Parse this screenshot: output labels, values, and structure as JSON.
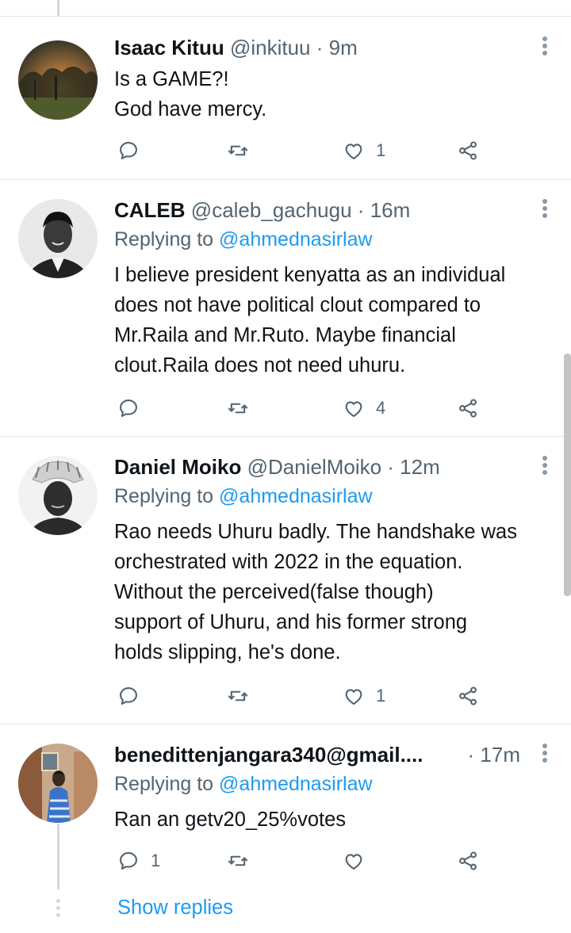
{
  "tweets": [
    {
      "name": "Isaac Kituu",
      "handle": "@inkituu",
      "dot": " · ",
      "time": "9m",
      "replying_prefix": "",
      "replying_to": "",
      "text": "Is a GAME?!\nGod have mercy.",
      "reply_count": "",
      "retweet_count": "",
      "like_count": "1",
      "avatar_icon": "avatar-sunset-trees"
    },
    {
      "name": "CALEB",
      "handle": "@caleb_gachugu",
      "dot": " · ",
      "time": "16m",
      "replying_prefix": "Replying to ",
      "replying_to": "@ahmednasirlaw",
      "text": "I believe president kenyatta as an individual\ndoes not have political clout compared to\nMr.Raila and Mr.Ruto. Maybe financial\nclout.Raila does not need uhuru.",
      "reply_count": "",
      "retweet_count": "",
      "like_count": "4",
      "avatar_icon": "avatar-man-suit"
    },
    {
      "name": "Daniel Moiko",
      "handle": "@DanielMoiko",
      "dot": " · ",
      "time": "12m",
      "replying_prefix": "Replying to ",
      "replying_to": "@ahmednasirlaw",
      "text": "Rao needs Uhuru badly. The handshake was\norchestrated with 2022 in the equation.\nWithout the perceived(false though)\nsupport of Uhuru, and his former strong\nholds slipping, he's done.",
      "reply_count": "",
      "retweet_count": "",
      "like_count": "1",
      "avatar_icon": "avatar-man-headdress"
    },
    {
      "name": "benedittenjangara340@gmail....",
      "handle": "",
      "dot": " · ",
      "time": "17m",
      "replying_prefix": "Replying to ",
      "replying_to": "@ahmednasirlaw",
      "text": "Ran an getv20_25%votes",
      "reply_count": "1",
      "retweet_count": "",
      "like_count": "",
      "avatar_icon": "avatar-woman-room"
    }
  ],
  "show_replies": "Show replies",
  "icons": {
    "reply": "reply-icon",
    "retweet": "retweet-icon",
    "like": "like-icon",
    "share": "share-icon",
    "more": "more-vertical-icon"
  },
  "colors": {
    "link": "#1d9bf0",
    "secondary": "#536471",
    "text": "#0f1419",
    "divider": "#e1e8ed"
  }
}
